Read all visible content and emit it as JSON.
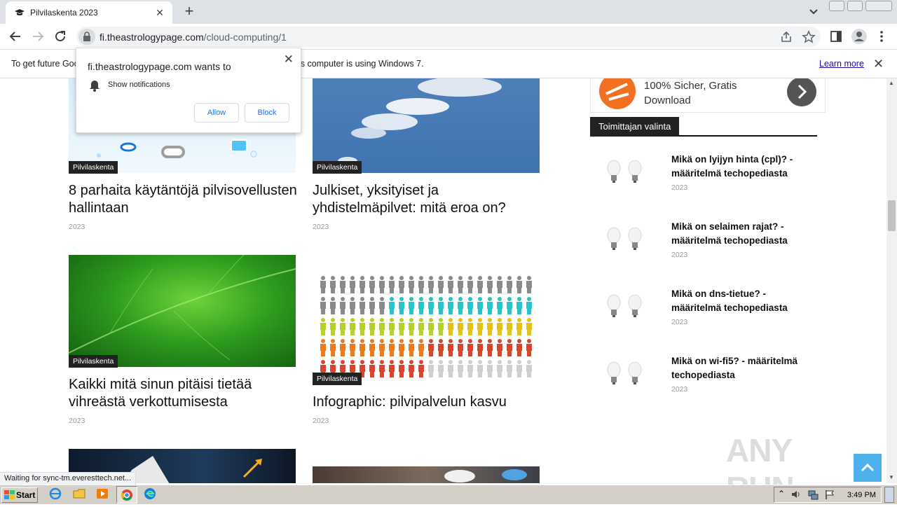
{
  "browser": {
    "tab_title": "Pilvilaskenta 2023",
    "url_host": "fi.theastrologypage.com",
    "url_path": "/cloud-computing/1"
  },
  "infobar": {
    "text": "To get future Google Chrome updates, you'll need Windows 10 or later. This computer is using Windows 7.",
    "link": "Learn more"
  },
  "notification": {
    "origin": "fi.theastrologypage.com wants to",
    "permission": "Show notifications",
    "allow": "Allow",
    "block": "Block"
  },
  "articles": [
    {
      "category": "Pilvilaskenta",
      "title": "8 parhaita käytäntöjä pilvisovellusten hallintaan",
      "year": "2023"
    },
    {
      "category": "Pilvilaskenta",
      "title": "Julkiset, yksityiset ja yhdistelmäpilvet: mitä eroa on?",
      "year": "2023"
    },
    {
      "category": "Pilvilaskenta",
      "title": "Kaikki mitä sinun pitäisi tietää vihreästä verkottumisesta",
      "year": "2023"
    },
    {
      "category": "Pilvilaskenta",
      "title": "Infographic: pilvipalvelun kasvu",
      "year": "2023"
    }
  ],
  "sidebar": {
    "ad_line1": "100% Sicher, Gratis",
    "ad_line2": "Download",
    "heading": "Toimittajan valinta",
    "items": [
      {
        "title": "Mikä on lyijyn hinta (cpl)? - määritelmä techopediasta",
        "year": "2023"
      },
      {
        "title": "Mikä on selaimen rajat? - määritelmä techopediasta",
        "year": "2023"
      },
      {
        "title": "Mikä on dns-tietue? - määritelmä techopediasta",
        "year": "2023"
      },
      {
        "title": "Mikä on wi-fi5? - määritelmä techopediasta",
        "year": "2023"
      }
    ]
  },
  "status": "Waiting for sync-tm.everesttech.net...",
  "taskbar": {
    "start": "Start",
    "clock": "3:49 PM"
  },
  "watermark": "ANY RUN",
  "colors": {
    "accent": "#4db2ec",
    "category_bg": "#222222",
    "link": "#1a0dab",
    "ad_orange": "#f36f21"
  },
  "icons": [
    "tab-favicon-icon",
    "close-icon",
    "plus-icon",
    "chevron-down-icon",
    "back-icon",
    "forward-icon",
    "reload-icon",
    "lock-icon",
    "share-icon",
    "star-icon",
    "sidepanel-icon",
    "profile-icon",
    "more-icon",
    "bell-icon",
    "arrow-up-icon",
    "windows-logo-icon"
  ]
}
